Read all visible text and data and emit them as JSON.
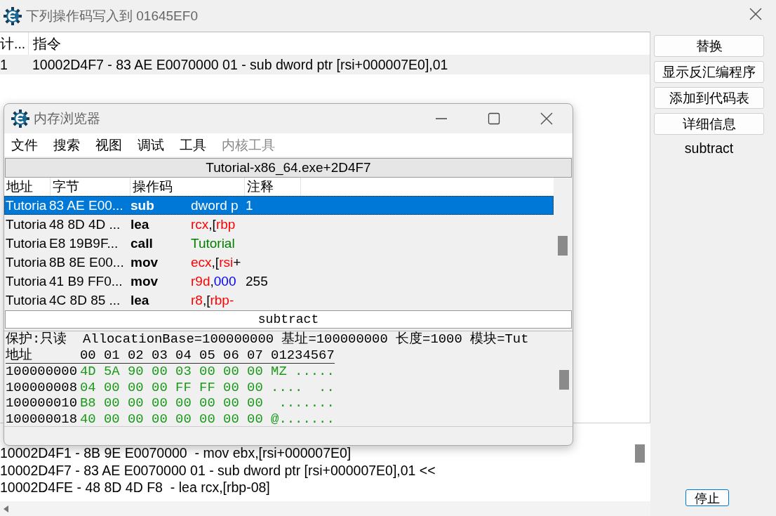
{
  "window": {
    "title": "下列操作码写入到 01645EF0"
  },
  "list": {
    "columns": [
      "计...",
      "指令"
    ],
    "rows": [
      {
        "cells": [
          "1",
          "10002D4F7 - 83 AE E0070000 01 - sub dword ptr [rsi+000007E0],01"
        ],
        "selected": true
      }
    ]
  },
  "buttons": [
    "替换",
    "显示反汇编程序",
    "添加到代码表",
    "详细信息"
  ],
  "info_text": "subtract",
  "disassembly_lines": [
    "10002D4F1 - 8B 9E E0070000  - mov ebx,[rsi+000007E0]",
    "10002D4F7 - 83 AE E0070000 01 - sub dword ptr [rsi+000007E0],01 <<",
    "10002D4FE - 48 8D 4D F8  - lea rcx,[rbp-08]"
  ],
  "stop_button": "停止",
  "memory_viewer": {
    "title": "内存浏览器",
    "menu": [
      {
        "label": "文件",
        "disabled": false
      },
      {
        "label": "搜索",
        "disabled": false
      },
      {
        "label": "视图",
        "disabled": false
      },
      {
        "label": "调试",
        "disabled": false
      },
      {
        "label": "工具",
        "disabled": false
      },
      {
        "label": "内核工具",
        "disabled": true
      }
    ],
    "address_bar": "Tutorial-x86_64.exe+2D4F7",
    "columns": [
      "地址",
      "字节",
      "操作码",
      "注释"
    ],
    "rows": [
      {
        "address": "Tutoria",
        "bytes": "83 AE E00...",
        "opcode": "sub",
        "operand": [
          {
            "text": "dword p",
            "kind": "text"
          }
        ],
        "comment": "1",
        "selected": true
      },
      {
        "address": "Tutoria",
        "bytes": "48 8D 4D ...",
        "opcode": "lea",
        "operand": [
          {
            "text": "rcx",
            "kind": "register"
          },
          {
            "text": ",[",
            "kind": "text"
          },
          {
            "text": "rbp",
            "kind": "register"
          }
        ],
        "selected": false
      },
      {
        "address": "Tutoria",
        "bytes": "E8 19B9F...",
        "opcode": "call",
        "operand": [
          {
            "text": "Tutorial",
            "kind": "symbol"
          }
        ],
        "selected": false
      },
      {
        "address": "Tutoria",
        "bytes": "8B 8E E00...",
        "opcode": "mov",
        "operand": [
          {
            "text": "ecx",
            "kind": "register"
          },
          {
            "text": ",[",
            "kind": "text"
          },
          {
            "text": "rsi",
            "kind": "register"
          },
          {
            "text": "+",
            "kind": "text"
          }
        ],
        "selected": false
      },
      {
        "address": "Tutoria",
        "bytes": "41 B9 FF0...",
        "opcode": "mov",
        "operand": [
          {
            "text": "r9d",
            "kind": "register"
          },
          {
            "text": ",",
            "kind": "text"
          },
          {
            "text": "000",
            "kind": "number"
          }
        ],
        "comment": "255",
        "selected": false
      },
      {
        "address": "Tutoria",
        "bytes": "4C 8D 85 ...",
        "opcode": "lea",
        "operand": [
          {
            "text": "r8",
            "kind": "register"
          },
          {
            "text": ",[",
            "kind": "text"
          },
          {
            "text": "rbp-",
            "kind": "register"
          }
        ],
        "selected": false
      }
    ],
    "comment_bar": "subtract",
    "hex": {
      "info": "保护:只读  AllocationBase=100000000 基址=100000000 长度=1000 模块=Tut",
      "header_address": "地址",
      "header_bytes": [
        "00",
        "01",
        "02",
        "03",
        "04",
        "05",
        "06",
        "07"
      ],
      "header_ascii": "01234567",
      "rows": [
        {
          "address": "100000000",
          "bytes": [
            "4D",
            "5A",
            "90",
            "00",
            "03",
            "00",
            "00",
            "00"
          ],
          "ascii": "MZ ....."
        },
        {
          "address": "100000008",
          "bytes": [
            "04",
            "00",
            "00",
            "00",
            "FF",
            "FF",
            "00",
            "00"
          ],
          "ascii": "....  .."
        },
        {
          "address": "100000010",
          "bytes": [
            "B8",
            "00",
            "00",
            "00",
            "00",
            "00",
            "00",
            "00"
          ],
          "ascii": " ......."
        },
        {
          "address": "100000018",
          "bytes": [
            "40",
            "00",
            "00",
            "00",
            "00",
            "00",
            "00",
            "00"
          ],
          "ascii": "@......."
        }
      ]
    }
  }
}
